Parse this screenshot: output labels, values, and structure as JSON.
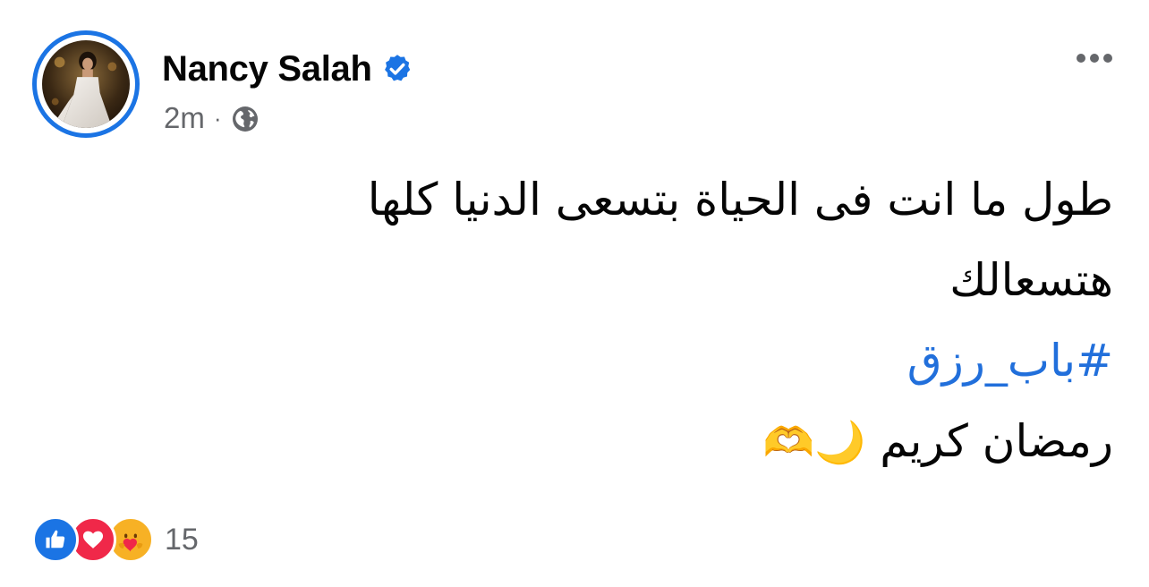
{
  "post": {
    "author": {
      "name": "Nancy Salah",
      "verified": true,
      "avatar_ring_color": "#1b74e4"
    },
    "meta": {
      "timestamp": "2m",
      "separator": "·",
      "audience_icon": "globe-icon"
    },
    "more_icon": "more-horizontal-icon",
    "text": {
      "line1": "طول ما انت فى الحياة بتسعى الدنيا كلها",
      "line2": "هتسعالك",
      "hashtag": "#باب_رزق",
      "line4_text": "رمضان كريم",
      "line4_emojis": "🌙🫶"
    },
    "reactions": {
      "icons": [
        "like-icon",
        "love-icon",
        "care-icon"
      ],
      "count": "15"
    },
    "colors": {
      "accent": "#1b74e4",
      "hashtag": "#216fdb",
      "secondary_text": "#65676b",
      "like": "#1b74e4",
      "love": "#f02849",
      "care": "#f7b125"
    }
  }
}
